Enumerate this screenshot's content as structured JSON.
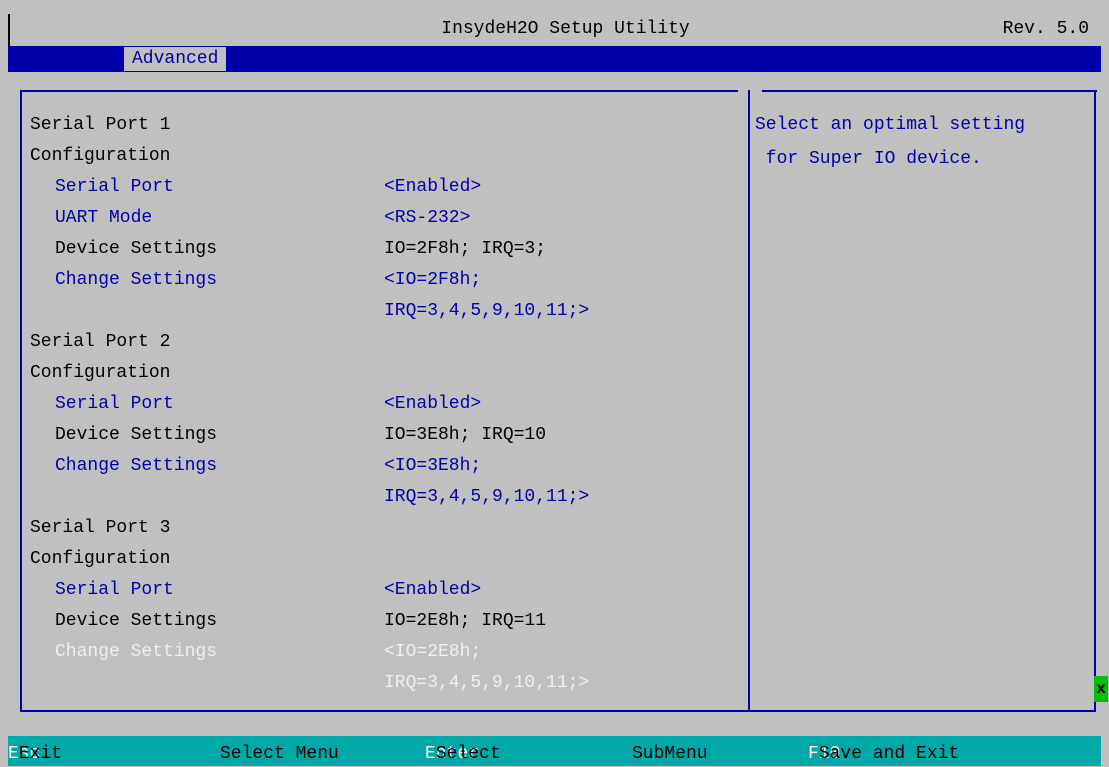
{
  "header": {
    "title": "InsydeH2O Setup Utility",
    "revision": "Rev. 5.0"
  },
  "menu": {
    "active_tab": "Advanced"
  },
  "settings": [
    {
      "label": "Serial Port 1",
      "value": "",
      "style": "heading"
    },
    {
      "label": "Configuration",
      "value": "",
      "style": "heading"
    },
    {
      "label": "Serial Port",
      "value": "<Enabled>",
      "style": "selectable"
    },
    {
      "label": "UART Mode",
      "value": "<RS-232>",
      "style": "selectable"
    },
    {
      "label": "Device Settings",
      "value": "IO=2F8h; IRQ=3;",
      "style": "static"
    },
    {
      "label": "Change Settings",
      "value": "<IO=2F8h;",
      "style": "selectable"
    },
    {
      "label": "",
      "value": "IRQ=3,4,5,9,10,11;>",
      "style": "selectable"
    },
    {
      "label": "Serial Port 2",
      "value": "",
      "style": "heading"
    },
    {
      "label": "Configuration",
      "value": "",
      "style": "heading"
    },
    {
      "label": "Serial Port",
      "value": "<Enabled>",
      "style": "selectable"
    },
    {
      "label": "Device Settings",
      "value": "IO=3E8h; IRQ=10",
      "style": "static"
    },
    {
      "label": "Change Settings",
      "value": "<IO=3E8h;",
      "style": "selectable"
    },
    {
      "label": "",
      "value": "IRQ=3,4,5,9,10,11;>",
      "style": "selectable"
    },
    {
      "label": "Serial Port 3",
      "value": "",
      "style": "heading"
    },
    {
      "label": "Configuration",
      "value": "",
      "style": "heading"
    },
    {
      "label": "Serial Port",
      "value": "<Enabled>",
      "style": "selectable"
    },
    {
      "label": "Device Settings",
      "value": "IO=2E8h; IRQ=11",
      "style": "static"
    },
    {
      "label": "Change Settings",
      "value": "<IO=2E8h;",
      "style": "highlighted"
    },
    {
      "label": "",
      "value": "IRQ=3,4,5,9,10,11;>",
      "style": "highlighted"
    }
  ],
  "help": {
    "text": "Select an optimal setting\n for Super IO device."
  },
  "scroll_marker": "x",
  "footer": [
    {
      "key": "Esc",
      "text": "Exit"
    },
    {
      "key": "",
      "text": "Select Menu"
    },
    {
      "key": "Enter",
      "text": "Select"
    },
    {
      "key": "",
      "text": "SubMenu"
    },
    {
      "key": "F10",
      "text": "Save and Exit"
    }
  ],
  "colors": {
    "background": "#c0c0c0",
    "accent_blue": "#0000a8",
    "footer_cyan": "#00a8a8",
    "highlight_white": "#f0f0f0"
  }
}
